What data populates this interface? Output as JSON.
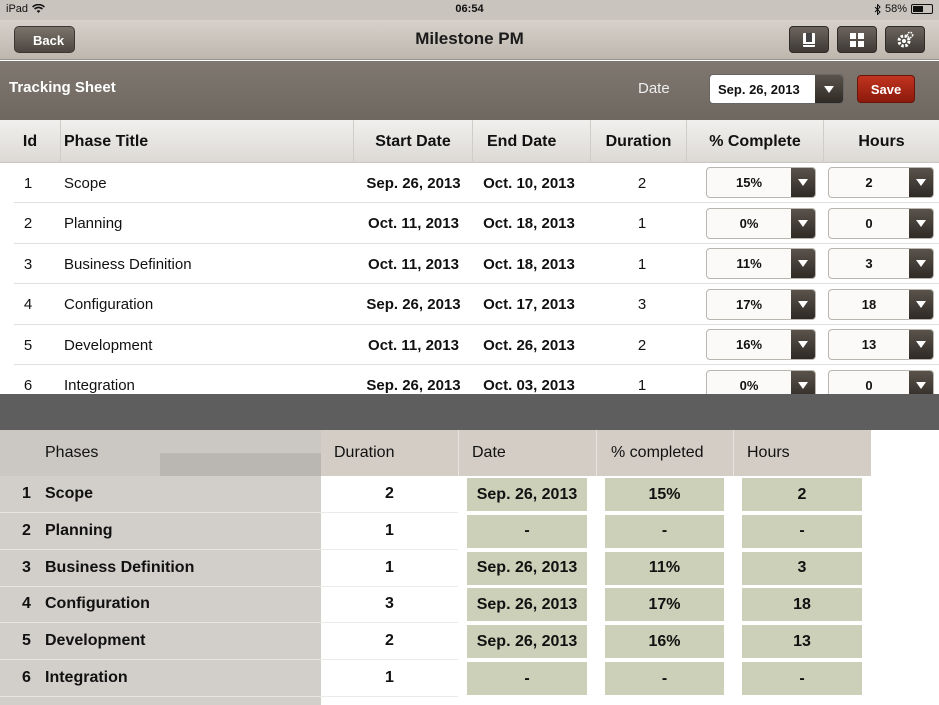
{
  "status_bar": {
    "device": "iPad",
    "time": "06:54",
    "battery": "58%",
    "battery_level": 0.58
  },
  "nav": {
    "back_label": "Back",
    "title": "Milestone PM",
    "icons": [
      "book-icon",
      "grid-icon",
      "settings-gear-icon"
    ]
  },
  "tracking": {
    "title": "Tracking Sheet",
    "date_label": "Date",
    "date_value": "Sep. 26, 2013",
    "save_label": "Save"
  },
  "top_table": {
    "headers": {
      "id": "Id",
      "phase": "Phase Title",
      "start": "Start Date",
      "end": "End Date",
      "duration": "Duration",
      "complete": "% Complete",
      "hours": "Hours"
    },
    "rows": [
      {
        "id": "1",
        "phase": "Scope",
        "start": "Sep. 26, 2013",
        "end": "Oct. 10, 2013",
        "duration": "2",
        "complete": "15%",
        "hours": "2"
      },
      {
        "id": "2",
        "phase": "Planning",
        "start": "Oct. 11, 2013",
        "end": "Oct. 18, 2013",
        "duration": "1",
        "complete": "0%",
        "hours": "0"
      },
      {
        "id": "3",
        "phase": "Business Definition",
        "start": "Oct. 11, 2013",
        "end": "Oct. 18, 2013",
        "duration": "1",
        "complete": "11%",
        "hours": "3"
      },
      {
        "id": "4",
        "phase": "Configuration",
        "start": "Sep. 26, 2013",
        "end": "Oct. 17, 2013",
        "duration": "3",
        "complete": "17%",
        "hours": "18"
      },
      {
        "id": "5",
        "phase": "Development",
        "start": "Oct. 11, 2013",
        "end": "Oct. 26, 2013",
        "duration": "2",
        "complete": "16%",
        "hours": "13"
      },
      {
        "id": "6",
        "phase": "Integration",
        "start": "Sep. 26, 2013",
        "end": "Oct. 03, 2013",
        "duration": "1",
        "complete": "0%",
        "hours": "0"
      }
    ]
  },
  "bottom_table": {
    "headers": {
      "phases": "Phases",
      "duration": "Duration",
      "date": "Date",
      "completed": "% completed",
      "hours": "Hours"
    },
    "rows": [
      {
        "id": "1",
        "phase": "Scope",
        "duration": "2",
        "date": "Sep. 26, 2013",
        "completed": "15%",
        "hours": "2"
      },
      {
        "id": "2",
        "phase": "Planning",
        "duration": "1",
        "date": "-",
        "completed": "-",
        "hours": "-"
      },
      {
        "id": "3",
        "phase": "Business Definition",
        "duration": "1",
        "date": "Sep. 26, 2013",
        "completed": "11%",
        "hours": "3"
      },
      {
        "id": "4",
        "phase": "Configuration",
        "duration": "3",
        "date": "Sep. 26, 2013",
        "completed": "17%",
        "hours": "18"
      },
      {
        "id": "5",
        "phase": "Development",
        "duration": "2",
        "date": "Sep. 26, 2013",
        "completed": "16%",
        "hours": "13"
      },
      {
        "id": "6",
        "phase": "Integration",
        "duration": "1",
        "date": "-",
        "completed": "-",
        "hours": "-"
      }
    ]
  },
  "colors": {
    "save": "#b02a17",
    "cell_fill": "#ccd0b8",
    "toolbar": "#766f68"
  }
}
